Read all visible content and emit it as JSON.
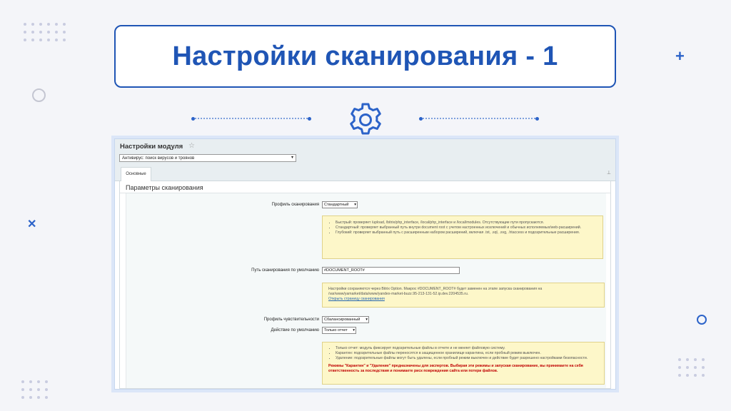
{
  "slide": {
    "title": "Настройки сканирования - 1"
  },
  "colors": {
    "accent": "#1f55b5",
    "background": "#f4f5f9",
    "note_bg": "#fdf7c9",
    "warning": "#c00000"
  },
  "screen": {
    "header_title": "Настройки модуля",
    "module_select": "Антивирус: поиск вирусов и троянов",
    "tab_main": "Основные",
    "section_title": "Параметры сканирования",
    "scan_profile": {
      "label": "Профиль сканирования",
      "value": "Стандартный"
    },
    "profile_notes": [
      "Быстрый: проверяет /upload, /bitrix/php_interface, /local/php_interface и /local/modules. Отсутствующие пути пропускаются.",
      "Стандартный: проверяет выбранный путь внутри document root с учетом настроенных исключений и обычных исполняемых/web-расширений.",
      "Глубокий: проверяет выбранный путь с расширенным набором расширений, включая .txt, .sql, .svg, .htaccess и подозрительные расширения."
    ],
    "scan_path": {
      "label": "Путь сканирования по умолчанию",
      "value": "#DOCUMENT_ROOT#"
    },
    "path_note": "Настройки сохраняются через Bitrix Option. Макрос #DOCUMENT_ROOT# будет заменен на этапе запуска сканирования на /var/www/yamarket/data/www/yandex-market-buzz.95-213-131-52.ip.dev.2204535.ru.",
    "path_note_link": "Открыть страницу сканирования",
    "sensitivity": {
      "label": "Профиль чувствительности",
      "value": "Сбалансированный"
    },
    "default_action": {
      "label": "Действие по умолчанию",
      "value": "Только отчет"
    },
    "action_notes": [
      "Только отчет: модуль фиксирует подозрительные файлы в отчете и не меняет файловую систему.",
      "Карантин: подозрительные файлы переносятся в защищенное хранилище карантина, если пробный режим выключен.",
      "Удаление: подозрительные файлы могут быть удалены, если пробный режим выключен и действие будет разрешено настройками безопасности."
    ],
    "action_warning": "Режимы \"Карантин\" и \"Удаление\" предназначены для экспертов. Выбирая эти режимы и запуская сканирование, вы принимаете на себя ответственность за последствия и понимаете риск повреждения сайта или потери файлов."
  },
  "icons": {
    "gear": "gear-icon",
    "star": "star-icon",
    "pin": "pin-icon"
  }
}
